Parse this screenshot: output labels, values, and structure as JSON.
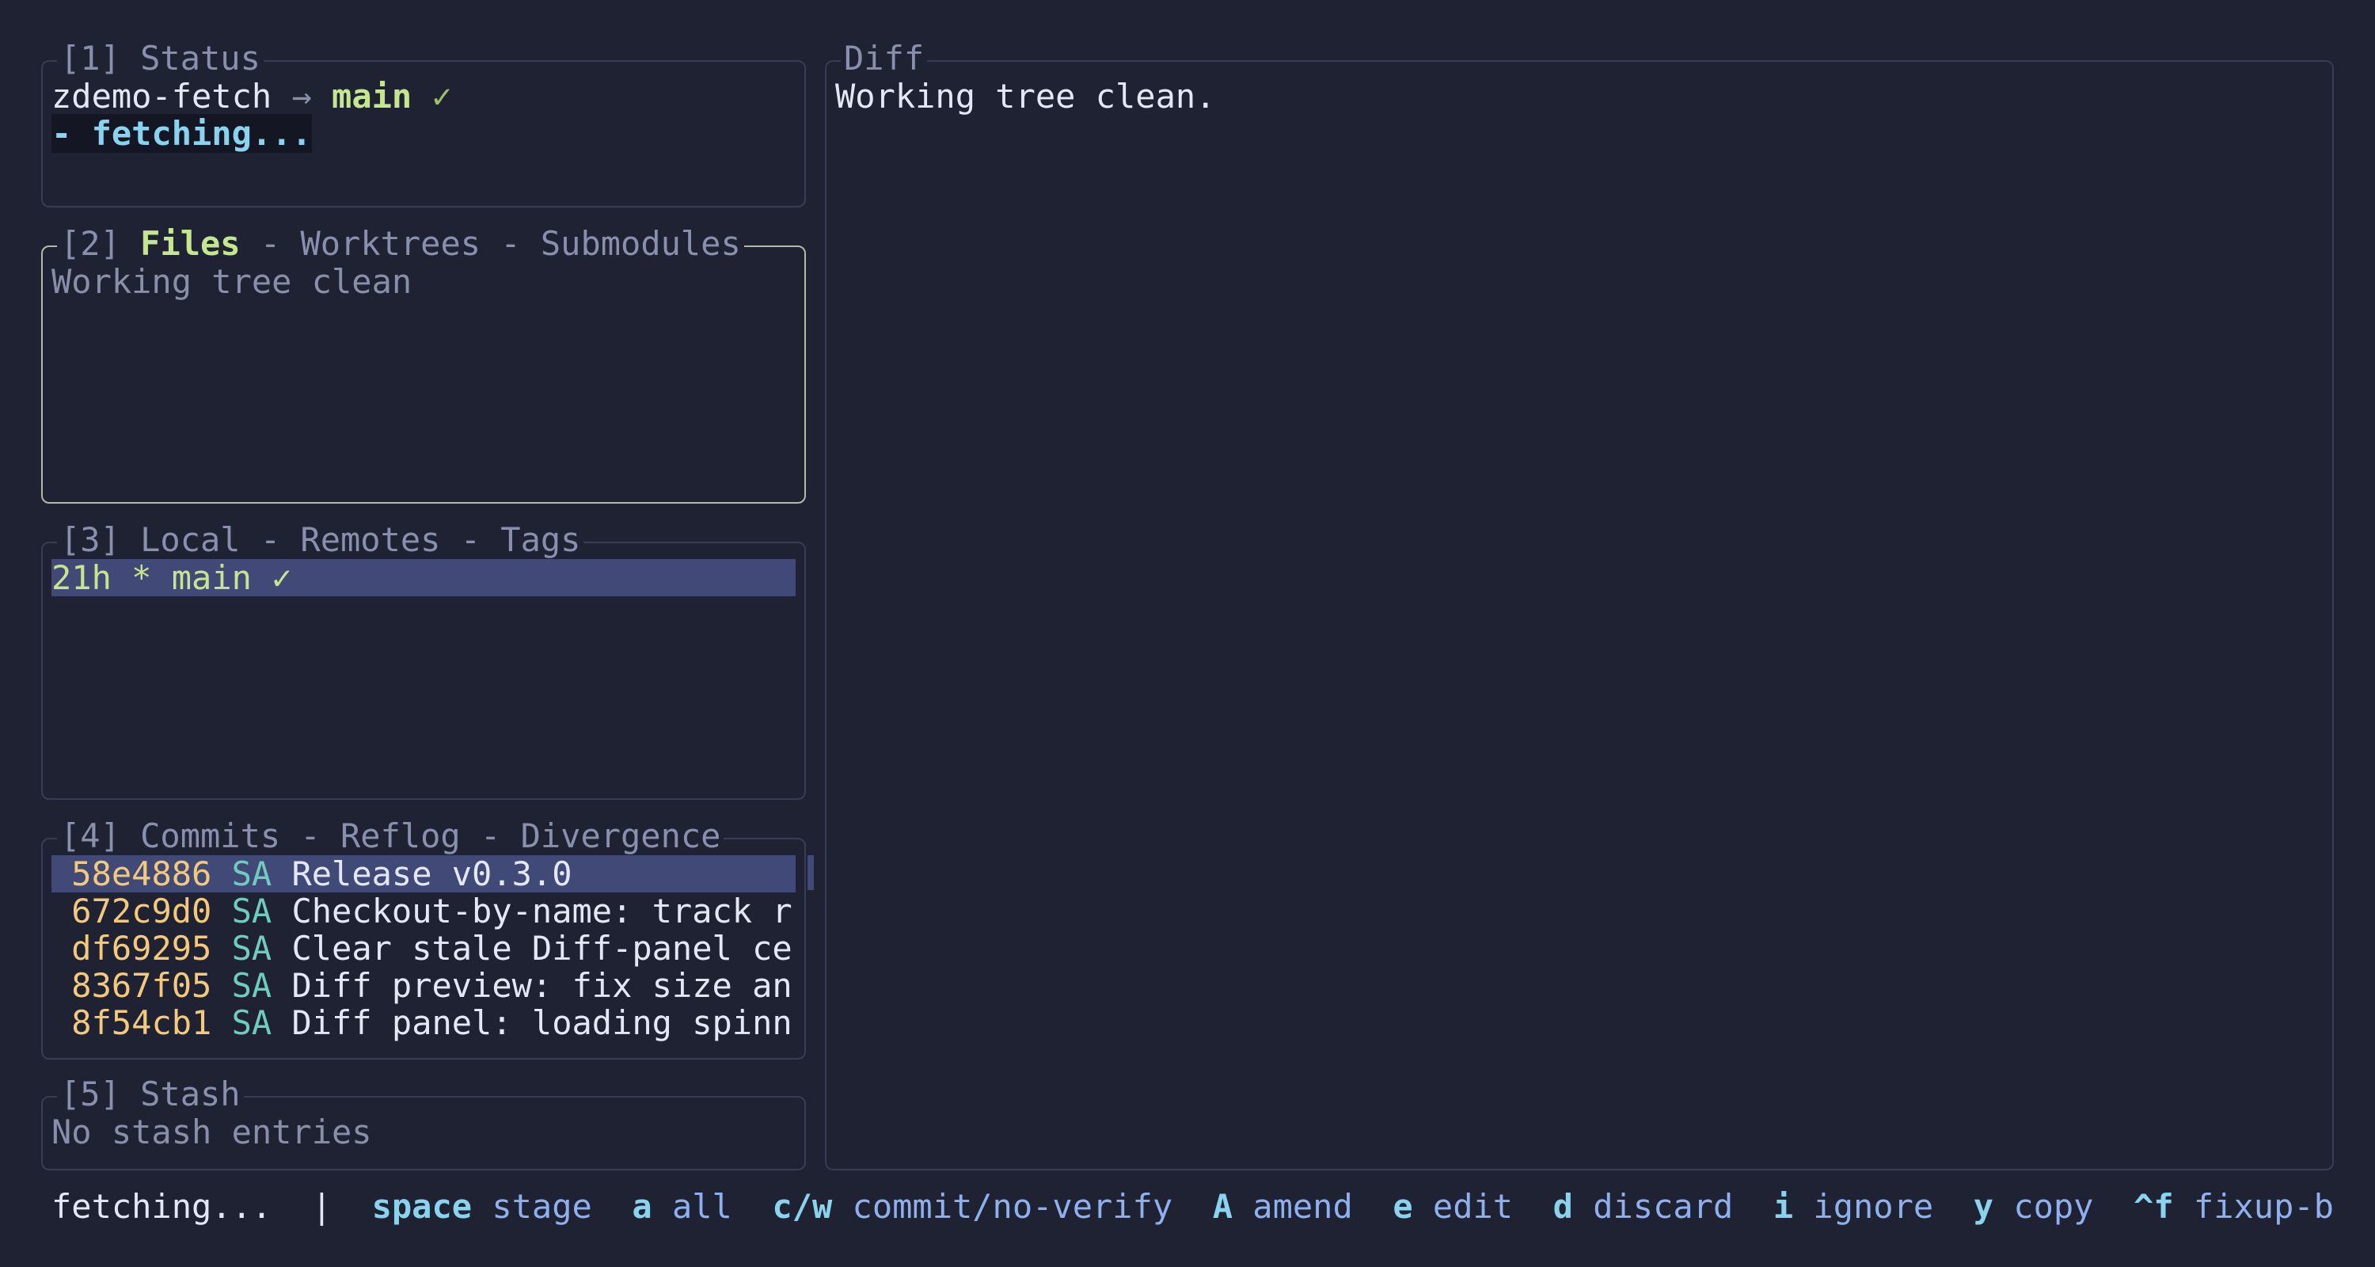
{
  "status_panel": {
    "title": "[1] Status",
    "repo": "zdemo-fetch",
    "arrow": "→",
    "branch": "main",
    "check": "✓",
    "fetch_line": "- fetching..."
  },
  "files_panel": {
    "num": "[2]",
    "tab_active": "Files",
    "tab_rest": "- Worktrees - Submodules",
    "empty_text": "Working tree clean"
  },
  "branches_panel": {
    "title": "[3] Local - Remotes - Tags",
    "row": {
      "age": "21h",
      "marker": "*",
      "name": "main",
      "check": "✓"
    }
  },
  "commits_panel": {
    "title": "[4] Commits - Reflog - Divergence",
    "commits": [
      {
        "hash": "58e4886",
        "author": "SA",
        "message": "Release v0.3.0"
      },
      {
        "hash": "672c9d0",
        "author": "SA",
        "message": "Checkout-by-name: track r"
      },
      {
        "hash": "df69295",
        "author": "SA",
        "message": "Clear stale Diff-panel ce"
      },
      {
        "hash": "8367f05",
        "author": "SA",
        "message": "Diff preview: fix size an"
      },
      {
        "hash": "8f54cb1",
        "author": "SA",
        "message": "Diff panel: loading spinn"
      }
    ]
  },
  "stash_panel": {
    "title": "[5] Stash",
    "empty_text": "No stash entries"
  },
  "diff_panel": {
    "title": "Diff",
    "content": "Working tree clean."
  },
  "status_bar": {
    "activity": "fetching...",
    "separator": "|",
    "keybindings": [
      {
        "key": "space",
        "label": "stage"
      },
      {
        "key": "a",
        "label": "all"
      },
      {
        "key": "c/w",
        "label": "commit/no-verify"
      },
      {
        "key": "A",
        "label": "amend"
      },
      {
        "key": "e",
        "label": "edit"
      },
      {
        "key": "d",
        "label": "discard"
      },
      {
        "key": "i",
        "label": "ignore"
      },
      {
        "key": "y",
        "label": "copy"
      },
      {
        "key": "^f",
        "label": "fixup-b"
      }
    ]
  },
  "colors": {
    "background": "#1f2233",
    "border": "#383c54",
    "active_border": "#b5b9a6",
    "selection": "#414a76",
    "accent_green": "#c6e58f",
    "accent_cyan": "#89d3ef",
    "hash_yellow": "#f5c97b",
    "author_teal": "#6fcdc0"
  }
}
